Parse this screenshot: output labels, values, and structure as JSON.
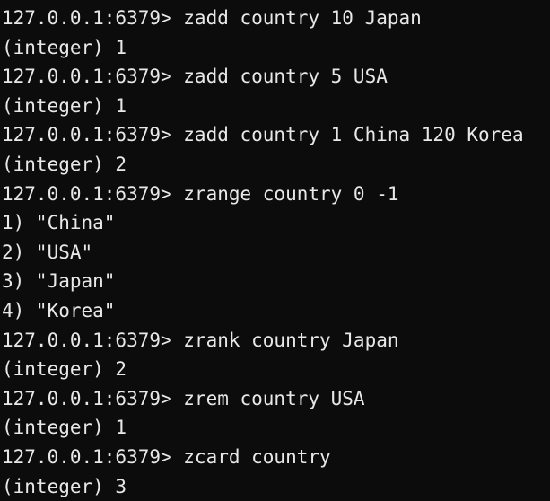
{
  "terminal": {
    "lines": [
      "127.0.0.1:6379> zadd country 10 Japan",
      "(integer) 1",
      "127.0.0.1:6379> zadd country 5 USA",
      "(integer) 1",
      "127.0.0.1:6379> zadd country 1 China 120 Korea",
      "(integer) 2",
      "127.0.0.1:6379> zrange country 0 -1",
      "1) \"China\"",
      "2) \"USA\"",
      "3) \"Japan\"",
      "4) \"Korea\"",
      "127.0.0.1:6379> zrank country Japan",
      "(integer) 2",
      "127.0.0.1:6379> zrem country USA",
      "(integer) 1",
      "127.0.0.1:6379> zcard country",
      "(integer) 3"
    ]
  },
  "colors": {
    "background": "#0c0c0c",
    "text": "#e8e8e8"
  }
}
